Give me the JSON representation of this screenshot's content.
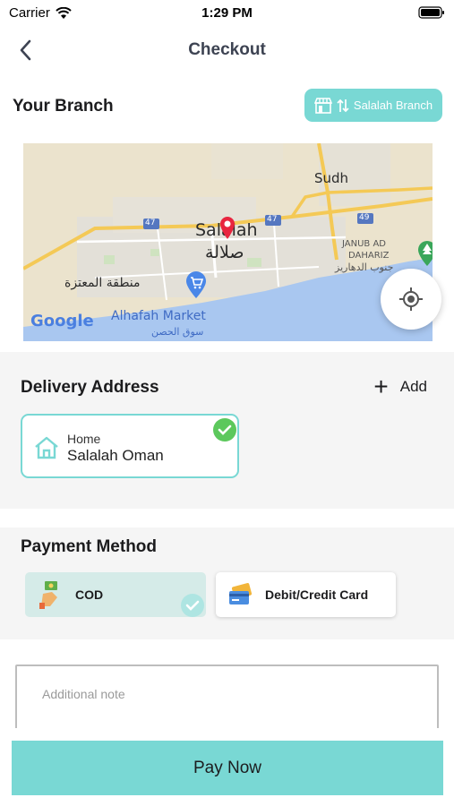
{
  "status_bar": {
    "carrier": "Carrier",
    "time": "1:29 PM"
  },
  "nav": {
    "title": "Checkout",
    "back_icon": "chevron-left-icon"
  },
  "branch": {
    "label": "Your Branch",
    "button_label": "Salalah Branch",
    "button_icons": [
      "store-icon",
      "swap-vertical-icon"
    ]
  },
  "map": {
    "labels": {
      "sudh": "Sudh",
      "salalah_en": "Salalah",
      "salalah_ar": "صلالة",
      "road_47_a": "47",
      "road_47_b": "47",
      "road_49": "49",
      "janub_line1": "JANUB AD",
      "janub_line2": "DAHARIZ",
      "dahariz_ar": "جنوب الدهاريز",
      "mutaza_ar": "منطقة المعتزة",
      "market_en": "Alhafah Market",
      "market_ar": "سوق الحصن",
      "google": "Google"
    },
    "icons": [
      "map-pin-icon",
      "shopping-cart-icon",
      "tree-icon",
      "crosshair-icon"
    ]
  },
  "delivery": {
    "title": "Delivery Address",
    "add_label": "Add",
    "address": {
      "type": "Home",
      "value": "Salalah Oman",
      "icon": "home-icon",
      "selected": true
    }
  },
  "payment": {
    "title": "Payment Method",
    "options": [
      {
        "label": "COD",
        "icon": "cash-hand-icon",
        "selected": true
      },
      {
        "label": "Debit/Credit Card",
        "icon": "credit-card-icon",
        "selected": false
      }
    ]
  },
  "note": {
    "placeholder": "Additional note"
  },
  "actions": {
    "pay_now": "Pay Now"
  },
  "colors": {
    "accent": "#79d8d4",
    "check_green": "#5cc85c",
    "text_dark": "#1c1c1e",
    "section_bg": "#f5f5f5"
  }
}
